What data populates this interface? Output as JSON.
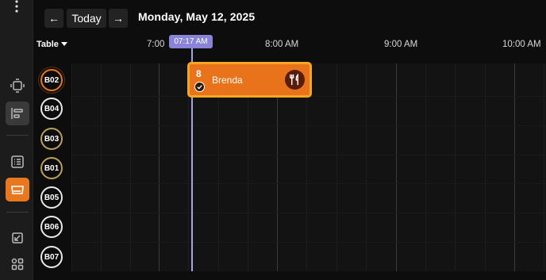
{
  "header": {
    "prev_label": "←",
    "today_label": "Today",
    "next_label": "→",
    "date": "Monday, May 12, 2025"
  },
  "view": {
    "selector_label": "Table"
  },
  "timeline": {
    "hours": [
      "7:00",
      "8:00 AM",
      "9:00 AM",
      "10:00 AM"
    ],
    "current_time": "07:17 AM"
  },
  "tables": [
    "B02",
    "B04",
    "B03",
    "B01",
    "B05",
    "B06",
    "B07"
  ],
  "reservation": {
    "party_size": "8",
    "guest_name": "Brenda",
    "status": "confirmed",
    "icon": "fork-knife-icon"
  },
  "colors": {
    "accent": "#e8781f",
    "now_marker": "#8a84d8",
    "reservation_border": "#f5a623"
  }
}
